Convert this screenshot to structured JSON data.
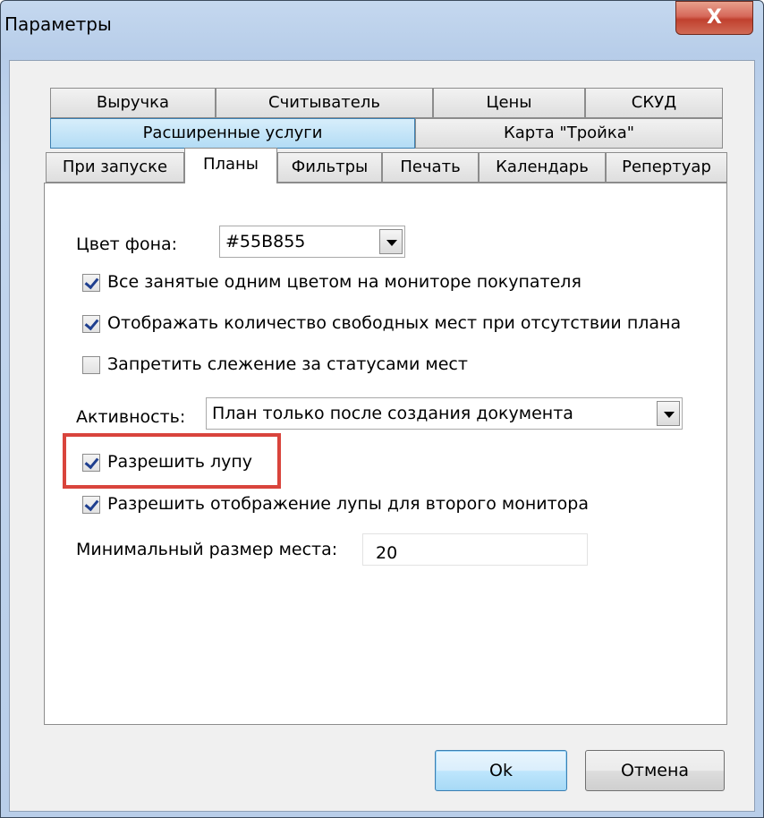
{
  "window": {
    "title": "Параметры",
    "close_icon": "close-icon",
    "close_glyph": "X"
  },
  "tabs": {
    "row1": [
      "Выручка",
      "Считыватель",
      "Цены",
      "СКУД"
    ],
    "row2": [
      "Расширенные услуги",
      "Карта \"Тройка\""
    ],
    "row3": [
      "При запуске",
      "Планы",
      "Фильтры",
      "Печать",
      "Календарь",
      "Репертуар"
    ],
    "active": "Планы"
  },
  "panel": {
    "bg_color_label": "Цвет фона:",
    "bg_color_value": "#55B855",
    "options": [
      {
        "label": "Все занятые одним цветом на мониторе покупателя",
        "checked": true
      },
      {
        "label": "Отображать количество свободных мест при отсутствии плана",
        "checked": true
      },
      {
        "label": "Запретить слежение за статусами мест",
        "checked": false
      }
    ],
    "activity_label": "Активность:",
    "activity_value": "План только после создания документа",
    "allow_magnifier": {
      "label": "Разрешить лупу",
      "checked": true
    },
    "allow_second_monitor": {
      "label": "Разрешить отображение лупы для второго монитора",
      "checked": true
    },
    "min_size_label": "Минимальный размер места:",
    "min_size_value": "20"
  },
  "buttons": {
    "ok": "Ok",
    "cancel": "Отмена"
  },
  "colors": {
    "highlight": "#d9443c",
    "tab_highlight": "#b3dcf5"
  }
}
